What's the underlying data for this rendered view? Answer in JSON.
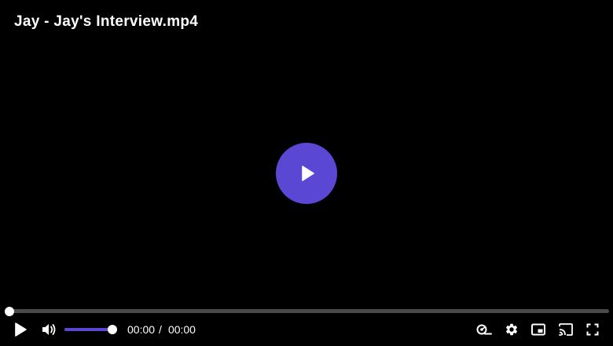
{
  "video": {
    "title": "Jay - Jay's Interview.mp4"
  },
  "playback": {
    "current_time": "00:00",
    "separator": "/",
    "duration": "00:00",
    "progress_fraction": 0,
    "volume_fraction": 0.92
  },
  "icons": {
    "big_play": "play-icon",
    "play": "play-icon",
    "volume": "volume-icon",
    "speed": "playback-speed-icon",
    "settings": "gear-icon",
    "pip": "picture-in-picture-icon",
    "cast": "cast-icon",
    "fullscreen": "fullscreen-icon"
  },
  "colors": {
    "accent": "#5a48d4",
    "background": "#000000",
    "track": "#4a4a4a",
    "text": "#ffffff"
  }
}
